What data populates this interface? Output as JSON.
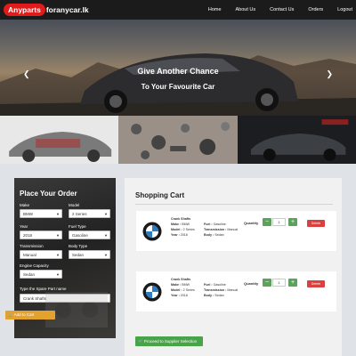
{
  "brand": {
    "highlight": "Anyparts",
    "rest": "foranycar.lk"
  },
  "nav": {
    "items": [
      "Home",
      "About Us",
      "Contact Us",
      "Orders",
      "Logout"
    ]
  },
  "hero": {
    "line1": "Give Another Chance",
    "line2": "To Your Favourite Car",
    "prev_icon": "chevron-left-icon",
    "next_icon": "chevron-right-icon"
  },
  "order": {
    "title": "Place Your Order",
    "make_label": "Make",
    "make_value": "BMW",
    "model_label": "Model",
    "model_value": "2 Series",
    "year_label": "Year",
    "year_value": "2018",
    "fuel_label": "Fuel Type",
    "fuel_value": "Gasoline",
    "transmission_label": "Transmission",
    "transmission_value": "Manual",
    "body_label": "Body Type",
    "body_value": "Sedan",
    "engine_label": "Engine Capacity",
    "engine_value": "Sedan",
    "spare_label": "Type the Spare Part name",
    "spare_value": "Crank Shafts",
    "add_button": "Add to Cart"
  },
  "cart": {
    "title": "Shopping Cart",
    "quantity_label": "Quantity",
    "delete_label": "Delete",
    "proceed_button": "Proceed to Supplier Selection",
    "items": [
      {
        "name": "Crank Shafts",
        "make_key": "Make :",
        "make": "BMW",
        "model_key": "Model :",
        "model": "2 Series",
        "year_key": "Year :",
        "year": "2018",
        "fuel_key": "Fuel :",
        "fuel": "Gasoline",
        "trans_key": "Transmission :",
        "trans": "Manual",
        "body_key": "Body :",
        "body": "Sedan",
        "qty": "1"
      },
      {
        "name": "Crank Shafts",
        "make_key": "Make :",
        "make": "BMW",
        "model_key": "Model :",
        "model": "2 Series",
        "year_key": "Year :",
        "year": "2018",
        "fuel_key": "Fuel :",
        "fuel": "Gasoline",
        "trans_key": "Transmission :",
        "trans": "Manual",
        "body_key": "Body :",
        "body": "Sedan",
        "qty": "1"
      }
    ]
  },
  "colors": {
    "nav_bg": "#1b1b1b",
    "brand_red": "#e01b1b",
    "add_orange": "#e3a22d",
    "qty_green": "#5ba35b",
    "delete_red": "#d94040",
    "proceed_green": "#47a447"
  }
}
